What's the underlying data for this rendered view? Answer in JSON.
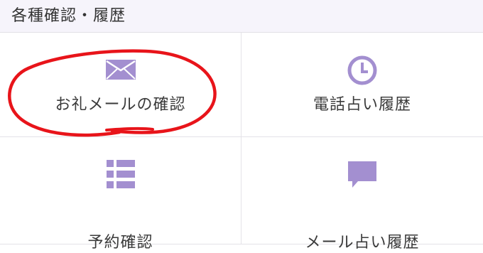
{
  "header": {
    "title": "各種確認・履歴"
  },
  "menu": {
    "items": [
      {
        "label": "お礼メールの確認",
        "icon": "envelope-icon"
      },
      {
        "label": "電話占い履歴",
        "icon": "clock-icon"
      },
      {
        "label": "予約確認",
        "icon": "list-icon"
      },
      {
        "label": "メール占い履歴",
        "icon": "chat-bubble-icon"
      }
    ]
  },
  "colors": {
    "icon": "#a38fd0",
    "header_background": "#f6f4fb",
    "annotation": "#e8141a"
  }
}
